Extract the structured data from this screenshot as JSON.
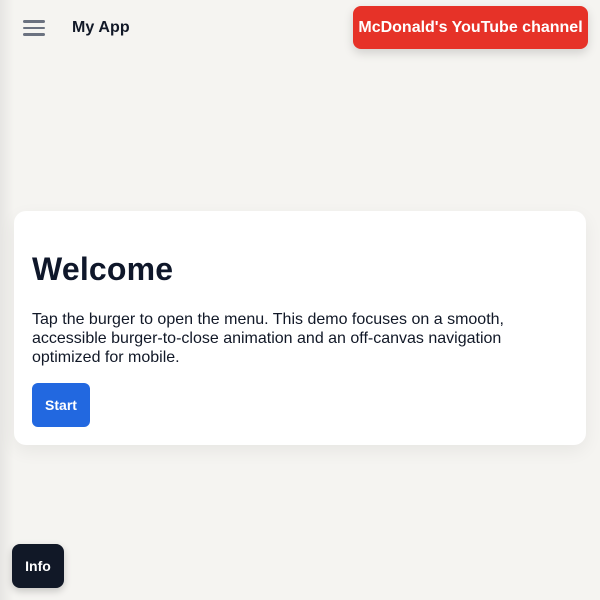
{
  "header": {
    "menu_icon": "hamburger-menu-icon",
    "app_title": "My App",
    "channel_button_label": "McDonald's YouTube channel"
  },
  "main": {
    "card": {
      "title": "Welcome",
      "body": "Tap the burger to open the menu. This demo focuses on a smooth, accessible burger-to-close animation and an off-canvas navigation optimized for mobile.",
      "start_label": "Start"
    }
  },
  "footer": {
    "info_label": "Info"
  },
  "colors": {
    "background": "#f5f4f1",
    "channel_button": "#e63228",
    "start_button": "#2268e0",
    "info_button": "#111827"
  }
}
